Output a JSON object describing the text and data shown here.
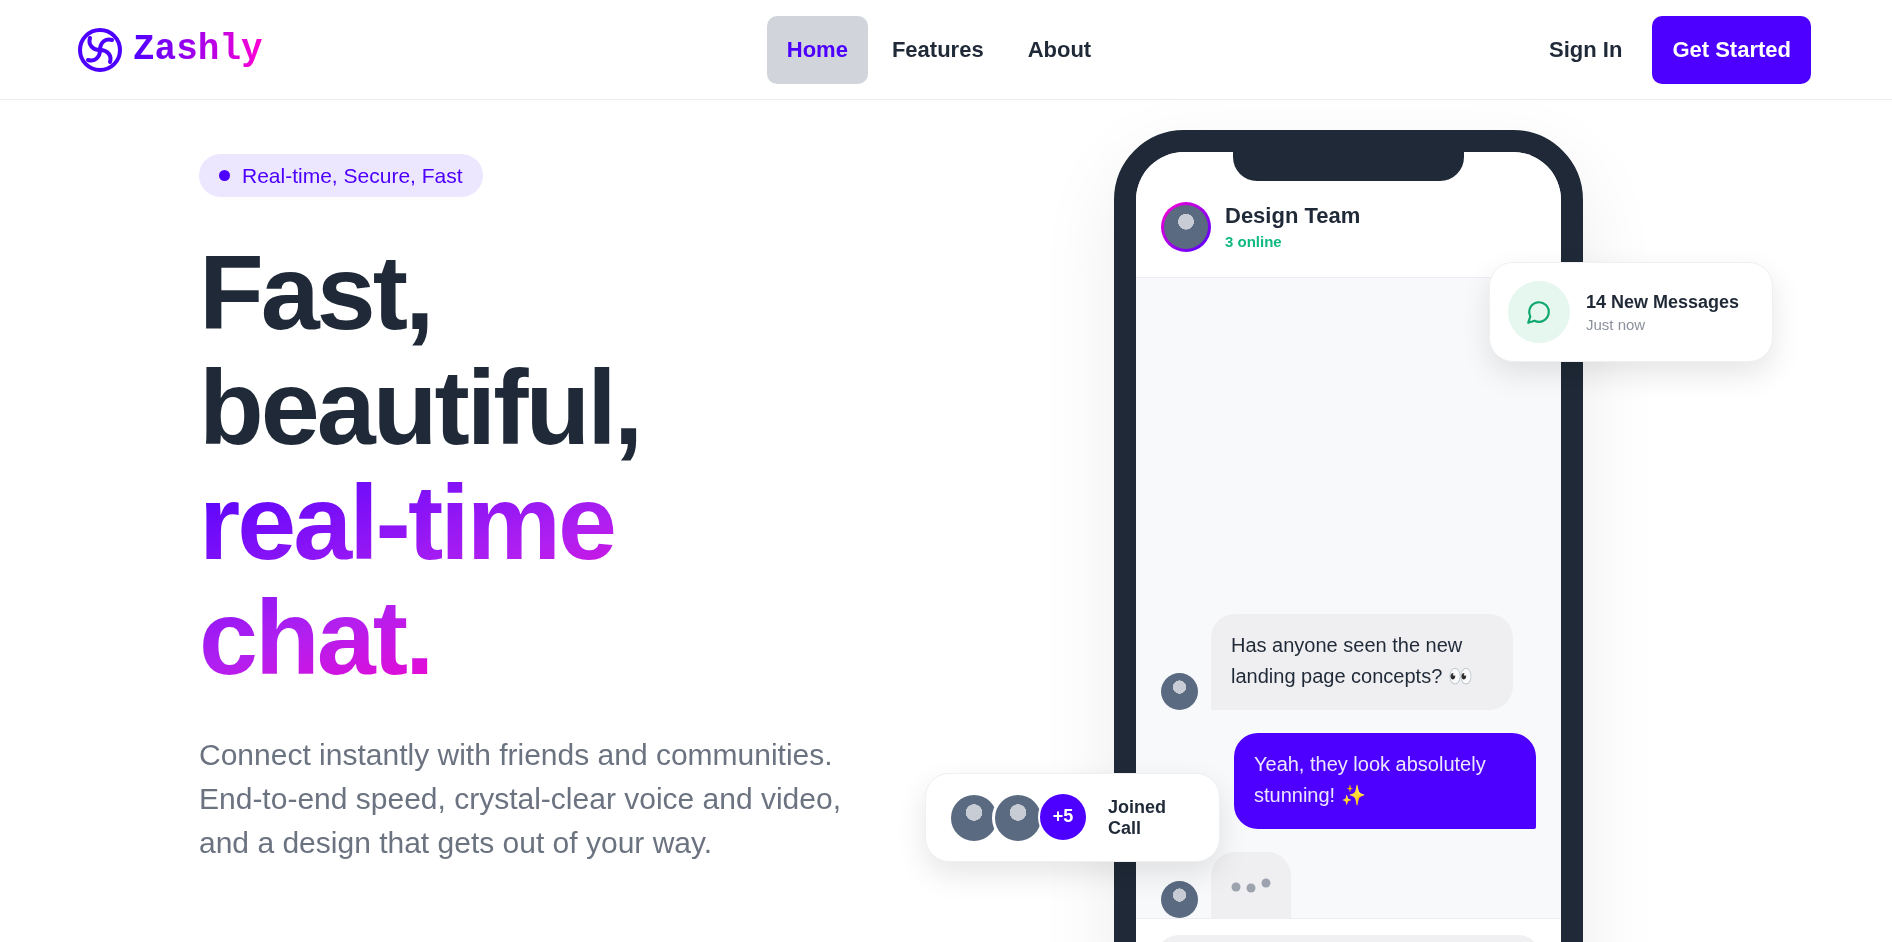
{
  "brand": {
    "name": "Zashly"
  },
  "nav": [
    {
      "label": "Home",
      "selected": true
    },
    {
      "label": "Features",
      "selected": false
    },
    {
      "label": "About",
      "selected": false
    }
  ],
  "auth": {
    "sign_in": "Sign In",
    "cta": "Get Started"
  },
  "hero": {
    "badge": "Real-time, Secure, Fast",
    "headline_lead": "Fast, beautiful,",
    "headline_highlight": "real-time chat.",
    "description": "Connect instantly with friends and communities. End-to-end speed, crystal-clear voice and video, and a design that gets out of your way."
  },
  "chat": {
    "title": "Design Team",
    "status": "3 online",
    "messages": [
      {
        "kind": "incoming",
        "text": "Has anyone seen the new landing page concepts? 👀"
      },
      {
        "kind": "outgoing",
        "text": "Yeah, they look absolutely stunning! ✨"
      },
      {
        "kind": "typing"
      }
    ]
  },
  "notification": {
    "title": "14 New Messages",
    "time": "Just now"
  },
  "call": {
    "extra": "+5",
    "label": "Joined Call"
  }
}
